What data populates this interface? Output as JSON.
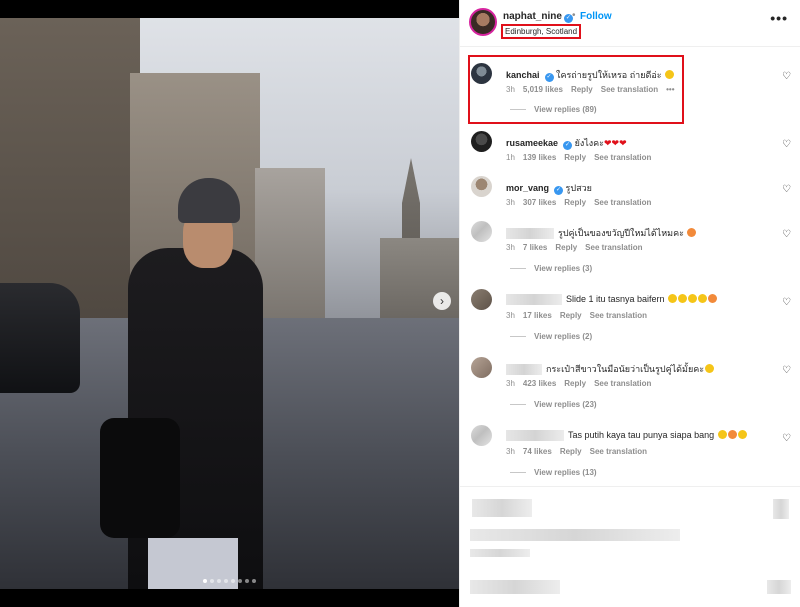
{
  "post": {
    "owner": "naphat_nine",
    "follow_sep": "•",
    "follow_label": "Follow",
    "location": "Edinburgh, Scotland",
    "more_label": "•••",
    "photo_count": 8,
    "photo_active_index": 0,
    "next_label": "›"
  },
  "comments": [
    {
      "user": "kanchai",
      "verified": true,
      "text": "ใครถ่ายรูปให้เหรอ ถ่ายดีอ่ะ",
      "time": "3h",
      "likes": "5,019 likes",
      "reply": "Reply",
      "translate": "See translation",
      "more": "•••",
      "view_replies": "View replies (89)"
    },
    {
      "user": "rusameekae",
      "verified": true,
      "text": "ยังไงคะ",
      "text_hearts": "❤❤❤",
      "time": "1h",
      "likes": "139 likes",
      "reply": "Reply",
      "translate": "See translation"
    },
    {
      "user": "mor_vang",
      "verified": true,
      "text": "รูปสวย",
      "time": "3h",
      "likes": "307 likes",
      "reply": "Reply",
      "translate": "See translation"
    },
    {
      "user": "",
      "text": "รูปคู่เป็นของขวัญปีใหม่ได้ไหมคะ",
      "time": "3h",
      "likes": "7 likes",
      "reply": "Reply",
      "translate": "See translation",
      "view_replies": "View replies (3)"
    },
    {
      "user": "",
      "text": "Slide 1 itu tasnya baifern",
      "time": "3h",
      "likes": "17 likes",
      "reply": "Reply",
      "translate": "See translation",
      "view_replies": "View replies (2)"
    },
    {
      "user": "",
      "text": "กระเป๋าสีขาวในมือนัยว่าเป็นรูปคู่ได้มั้ยคะ",
      "time": "3h",
      "likes": "423 likes",
      "reply": "Reply",
      "translate": "See translation",
      "view_replies": "View replies (23)"
    },
    {
      "user": "",
      "text": "Tas putih kaya tau punya siapa bang",
      "time": "3h",
      "likes": "74 likes",
      "reply": "Reply",
      "translate": "See translation",
      "view_replies": "View replies (13)"
    }
  ],
  "icons": {
    "heart": "♡",
    "check": "✓"
  },
  "colors": {
    "accent": "#0095f6",
    "verified": "#3897f0",
    "highlight": "#e0101a"
  }
}
